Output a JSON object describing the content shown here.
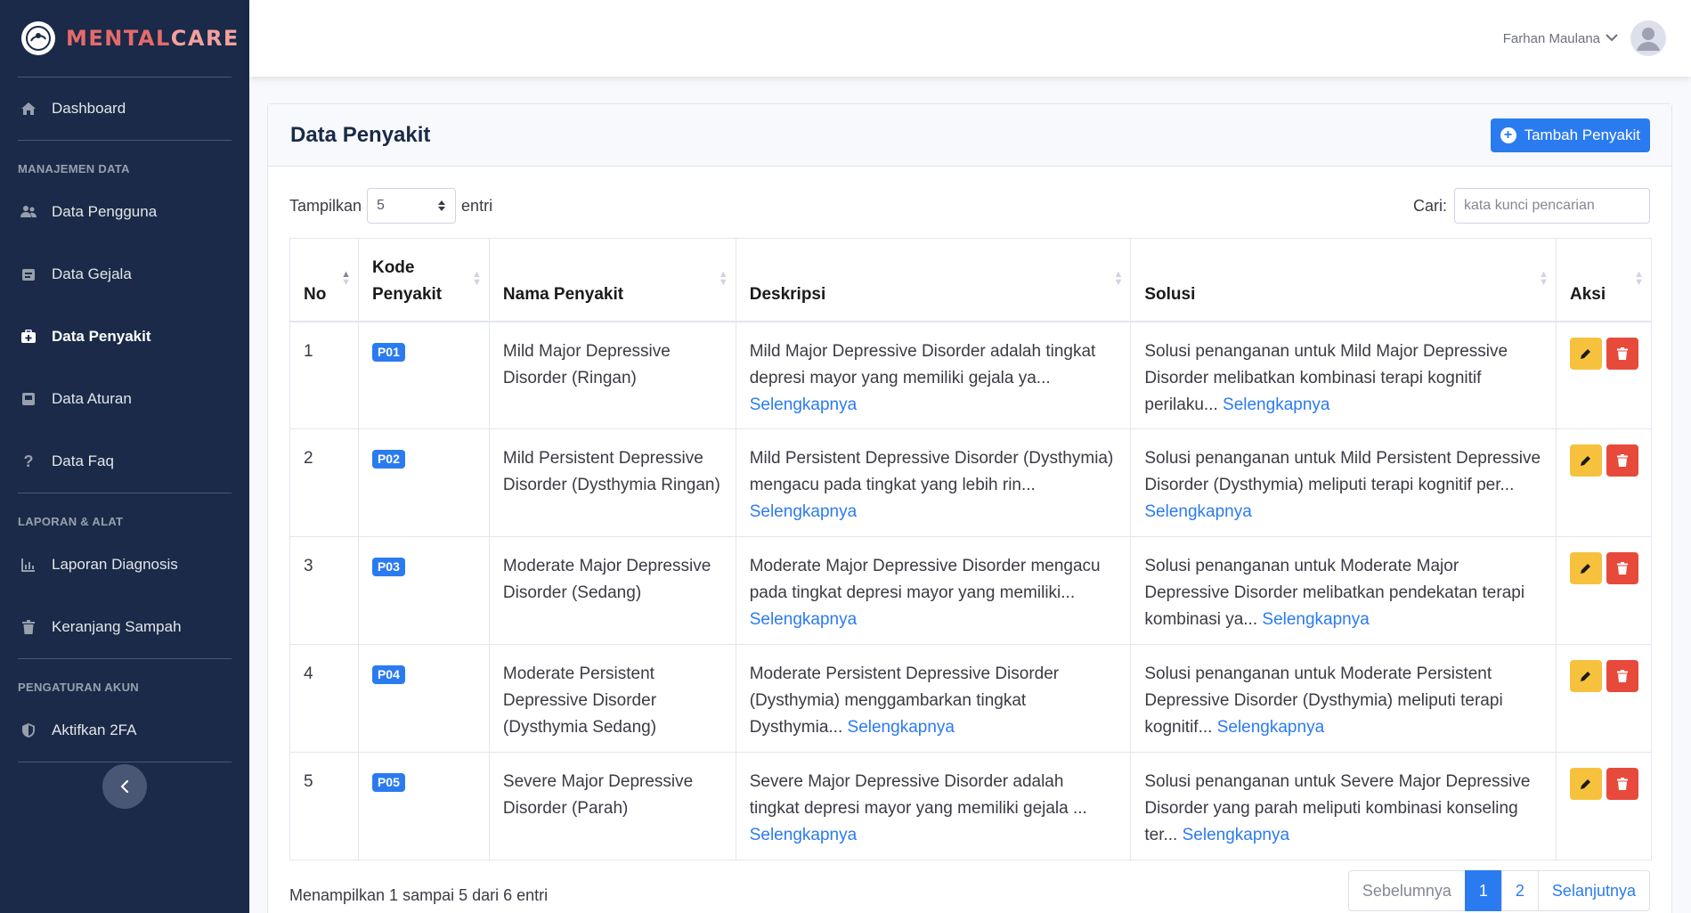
{
  "brand": {
    "part1": "MENTAL",
    "part2": "CARE"
  },
  "sidebar": {
    "dashboard": "Dashboard",
    "sections": {
      "manajemen": "MANAJEMEN DATA",
      "laporan": "LAPORAN & ALAT",
      "pengaturan": "PENGATURAN AKUN"
    },
    "items": {
      "pengguna": "Data Pengguna",
      "gejala": "Data Gejala",
      "penyakit": "Data Penyakit",
      "aturan": "Data Aturan",
      "faq": "Data Faq",
      "laporan_diagnosis": "Laporan Diagnosis",
      "sampah": "Keranjang Sampah",
      "twofa": "Aktifkan 2FA"
    }
  },
  "topbar": {
    "user_name": "Farhan Maulana"
  },
  "card": {
    "title": "Data Penyakit",
    "add_label": "Tambah Penyakit"
  },
  "controls": {
    "show_label": "Tampilkan",
    "show_value": "5",
    "entries_label": "entri",
    "search_label": "Cari:",
    "search_placeholder": "kata kunci pencarian"
  },
  "table": {
    "headers": {
      "no": "No",
      "kode_1": "Kode",
      "kode_2": "Penyakit",
      "nama": "Nama Penyakit",
      "deskripsi": "Deskripsi",
      "solusi": "Solusi",
      "aksi": "Aksi"
    },
    "more_label": "Selengkapnya",
    "rows": [
      {
        "no": "1",
        "kode": "P01",
        "nama": "Mild Major Depressive Disorder (Ringan)",
        "deskripsi": "Mild Major Depressive Disorder adalah tingkat depresi mayor yang memiliki gejala ya...",
        "solusi": "Solusi penanganan untuk Mild Major Depressive Disorder melibatkan kombinasi terapi kognitif perilaku..."
      },
      {
        "no": "2",
        "kode": "P02",
        "nama": "Mild Persistent Depressive Disorder (Dysthymia Ringan)",
        "deskripsi": "Mild Persistent Depressive Disorder (Dysthymia) mengacu pada tingkat yang lebih rin...",
        "solusi": "Solusi penanganan untuk Mild Persistent Depressive Disorder (Dysthymia) meliputi terapi kognitif per..."
      },
      {
        "no": "3",
        "kode": "P03",
        "nama": "Moderate Major Depressive Disorder (Sedang)",
        "deskripsi": "Moderate Major Depressive Disorder mengacu pada tingkat depresi mayor yang memiliki...",
        "solusi": "Solusi penanganan untuk Moderate Major Depressive Disorder melibatkan pendekatan terapi kombinasi ya..."
      },
      {
        "no": "4",
        "kode": "P04",
        "nama": "Moderate Persistent Depressive Disorder (Dysthymia Sedang)",
        "deskripsi": "Moderate Persistent Depressive Disorder (Dysthymia) menggambarkan tingkat Dysthymia...",
        "solusi": "Solusi penanganan untuk Moderate Persistent Depressive Disorder (Dysthymia) meliputi terapi kognitif..."
      },
      {
        "no": "5",
        "kode": "P05",
        "nama": "Severe Major Depressive Disorder (Parah)",
        "deskripsi": "Severe Major Depressive Disorder adalah tingkat depresi mayor yang memiliki gejala ...",
        "solusi": "Solusi penanganan untuk Severe Major Depressive Disorder yang parah meliputi kombinasi konseling ter..."
      }
    ]
  },
  "footer": {
    "info": "Menampilkan 1 sampai 5 dari 6 entri",
    "prev": "Sebelumnya",
    "page1": "1",
    "page2": "2",
    "next": "Selanjutnya"
  },
  "colors": {
    "sidebar": "#1a2a48",
    "primary": "#2b7bf0",
    "warning": "#f6c23e",
    "danger": "#e74a3b",
    "brand": "#e56b6b"
  },
  "icons": {
    "dashboard": "home-icon",
    "pengguna": "users-icon",
    "gejala": "clipboard-icon",
    "penyakit": "medkit-icon",
    "aturan": "book-icon",
    "faq": "question-icon",
    "laporan": "chart-icon",
    "sampah": "trash-icon",
    "twofa": "shield-icon",
    "edit": "pencil-icon",
    "delete": "trash-icon"
  }
}
